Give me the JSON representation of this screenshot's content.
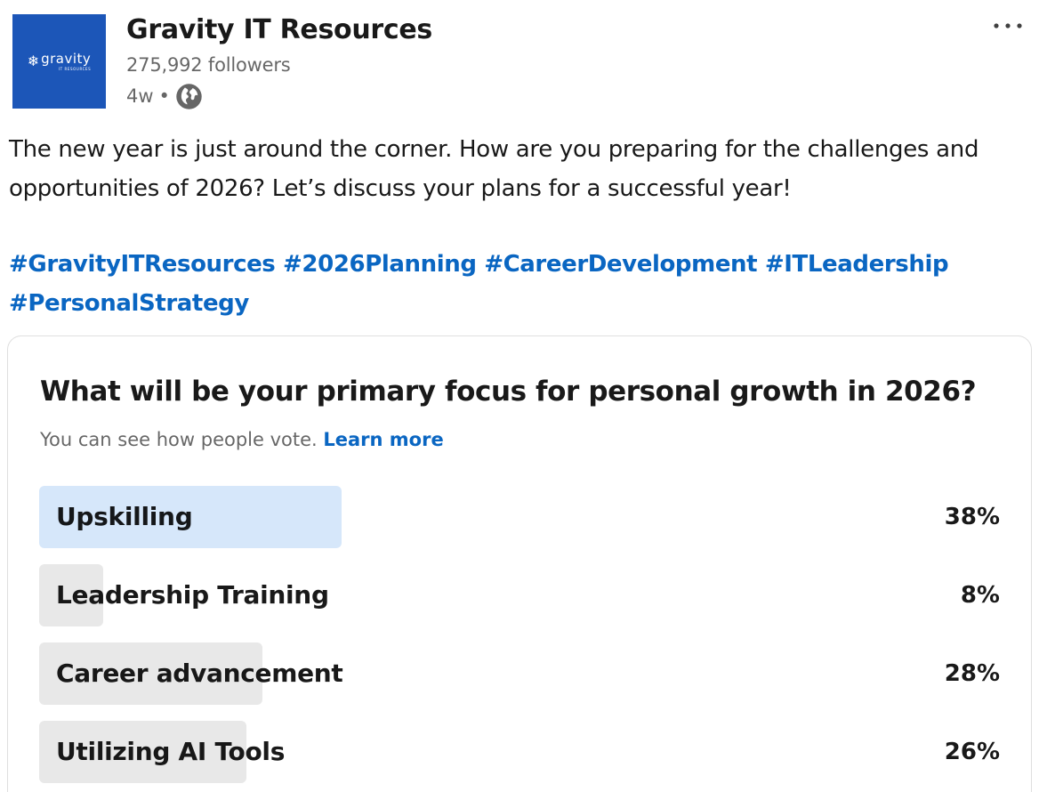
{
  "company": {
    "name": "Gravity IT Resources",
    "followers": "275,992 followers",
    "age": "4w",
    "separator": "•",
    "visibility_icon": "globe-icon",
    "logo_text": "gravity",
    "logo_subtext": "IT RESOURCES",
    "logo_color": "#1c56b8"
  },
  "post": {
    "text": "The new year is just around the corner. How are you preparing for the challenges and opportunities of 2026? Let’s discuss your plans for a successful year!",
    "hashtags": [
      "#GravityITResources",
      "#2026Planning",
      "#CareerDevelopment",
      "#ITLeadership",
      "#PersonalStrategy"
    ]
  },
  "poll": {
    "question": "What will be your primary focus for personal growth in 2026?",
    "note": "You can see how people vote.",
    "learn_more": "Learn more",
    "options": [
      {
        "label": "Upskilling",
        "percent": "38%",
        "value": 38,
        "leading": true
      },
      {
        "label": "Leadership Training",
        "percent": "8%",
        "value": 8,
        "leading": false
      },
      {
        "label": "Career advancement",
        "percent": "28%",
        "value": 28,
        "leading": false
      },
      {
        "label": "Utilizing AI Tools",
        "percent": "26%",
        "value": 26,
        "leading": false
      }
    ]
  },
  "colors": {
    "link": "#0a66c2",
    "leading_bar": "#d6e7fa",
    "bar": "#e8e8e8"
  }
}
